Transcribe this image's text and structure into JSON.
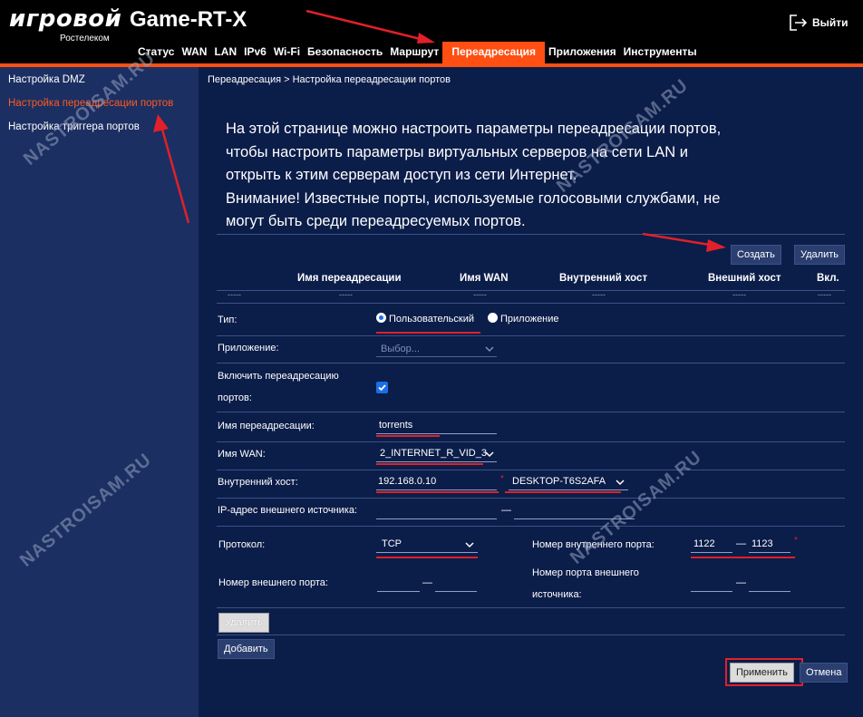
{
  "header": {
    "logo_main": "игровой",
    "logo_sub": "Ростелеком",
    "model": "Game-RT-X",
    "logout_label": "Выйти"
  },
  "nav": {
    "items": [
      "Статус",
      "WAN",
      "LAN",
      "IPv6",
      "Wi-Fi",
      "Безопасность",
      "Маршрут",
      "Переадресация",
      "Приложения",
      "Инструменты"
    ],
    "active": "Переадресация"
  },
  "sidebar": {
    "items": [
      "Настройка DMZ",
      "Настройка переадресации портов",
      "Настройка триггера портов"
    ],
    "active": "Настройка переадресации портов"
  },
  "breadcrumb": "Переадресация > Настройка переадресации портов",
  "intro": {
    "line1": "На этой странице можно настроить параметры переадресации портов,",
    "line2": "чтобы настроить параметры виртуальных серверов на сети LAN и",
    "line3": "открыть к этим серверам доступ из сети Интернет.",
    "line4": "Внимание! Известные порты, используемые голосовыми службами, не",
    "line5": "могут быть среди переадресуемых портов."
  },
  "table_buttons": {
    "create": "Создать",
    "delete": "Удалить"
  },
  "table": {
    "columns": [
      "Имя переадресации",
      "Имя WAN",
      "Внутренний хост",
      "Внешний хост",
      "Вкл."
    ],
    "empty_cell": "-----"
  },
  "form": {
    "type_label": "Тип:",
    "type_options": [
      "Пользовательский",
      "Приложение"
    ],
    "type_selected": "Пользовательский",
    "app_label": "Приложение:",
    "app_placeholder": "Выбор...",
    "enable_label_1": "Включить переадресацию",
    "enable_label_2": "портов:",
    "enable_checked": true,
    "name_label": "Имя переадресации:",
    "name_value": "torrents",
    "wan_label": "Имя WAN:",
    "wan_value": "2_INTERNET_R_VID_3",
    "host_label": "Внутренний хост:",
    "host_ip": "192.168.0.10",
    "host_name": "DESKTOP-T6S2AFA",
    "src_ip_label": "IP-адрес внешнего источника:",
    "range_sep": "—",
    "required_mark": "*",
    "protocol_label": "Протокол:",
    "protocol_value": "TCP",
    "int_port_label": "Номер внутреннего порта:",
    "int_port_from": "1122",
    "int_port_to": "1123",
    "ext_port_label": "Номер внешнего порта:",
    "ext_src_port_label_1": "Номер порта внешнего",
    "ext_src_port_label_2": "источника:",
    "row_delete": "Удалить",
    "row_add": "Добавить"
  },
  "actions": {
    "apply": "Применить",
    "cancel": "Отмена"
  },
  "watermark": "NASTROISAM.RU",
  "colors": {
    "background": "#0b1d49",
    "sidebar": "#1b2f62",
    "accent": "#ff4f12",
    "highlight": "#e0202a",
    "checkbox": "#1a6fe8"
  }
}
